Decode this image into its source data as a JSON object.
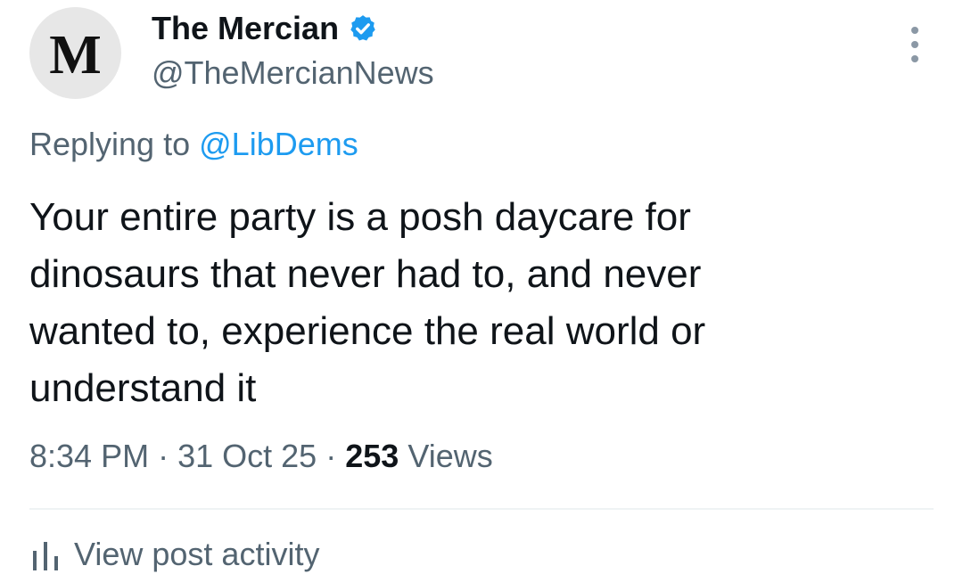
{
  "author": {
    "avatar_letter": "M",
    "display_name": "The Mercian",
    "handle": "@TheMercianNews",
    "verified_icon": "verified-badge-icon",
    "verified_color": "#1d9bf0"
  },
  "more_icon": "more-options-icon",
  "reply": {
    "prefix": "Replying to",
    "target": "@LibDems"
  },
  "tweet": {
    "lines": [
      "Your entire party is a posh daycare for",
      "dinosaurs that never had to, and never",
      "wanted to, experience the real world or",
      "understand it"
    ]
  },
  "meta": {
    "time": "8:34 PM",
    "separator": "·",
    "date": "31 Oct 25",
    "views_count": "253",
    "views_label": "Views"
  },
  "activity": {
    "icon": "bar-chart-icon",
    "label": "View post activity"
  },
  "colors": {
    "text": "#0f1419",
    "secondary": "#536471",
    "link": "#1d9bf0",
    "avatar_bg": "#e7e7e7"
  }
}
